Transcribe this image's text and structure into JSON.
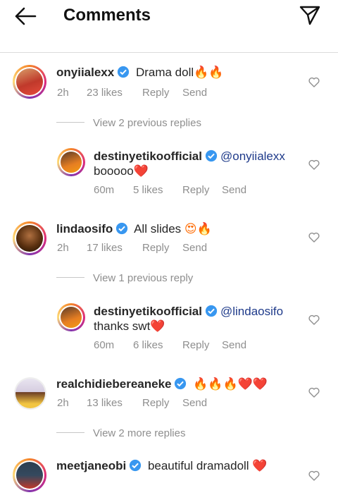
{
  "header": {
    "title": "Comments"
  },
  "comments": [
    {
      "username": "onyiialexx",
      "text": "Drama doll",
      "emoji": "🔥🔥",
      "time": "2h",
      "likes": "23 likes",
      "reply": "Reply",
      "send": "Send"
    },
    {
      "username": "lindaosifo",
      "text": "All slides",
      "emoji": "😍🔥",
      "time": "2h",
      "likes": "17 likes",
      "reply": "Reply",
      "send": "Send"
    },
    {
      "username": "realchidiebereaneke",
      "text": "",
      "emoji": "🔥🔥🔥❤️❤️",
      "time": "2h",
      "likes": "13 likes",
      "reply": "Reply",
      "send": "Send"
    },
    {
      "username": "meetjaneobi",
      "text": "beautiful dramadoll",
      "emoji": "❤️"
    }
  ],
  "replies": [
    {
      "username": "destinyetikoofficial",
      "mention": "@onyiialexx",
      "text": "booooo",
      "emoji": "❤️",
      "time": "60m",
      "likes": "5 likes",
      "reply": "Reply",
      "send": "Send"
    },
    {
      "username": "destinyetikoofficial",
      "mention": "@lindaosifo",
      "text": "thanks swt",
      "emoji": "❤️",
      "time": "60m",
      "likes": "6 likes",
      "reply": "Reply",
      "send": "Send"
    }
  ],
  "view_replies": [
    "View 2 previous replies",
    "View 1 previous reply",
    "View 2 more replies"
  ],
  "icons": {
    "back": "arrow-left-icon",
    "direct": "paper-plane-icon",
    "like": "heart-outline-icon",
    "verified": "verified-badge-icon"
  },
  "colors": {
    "verified": "#3897f0",
    "mention": "#1e3a8a",
    "meta": "#8e8e8e"
  }
}
